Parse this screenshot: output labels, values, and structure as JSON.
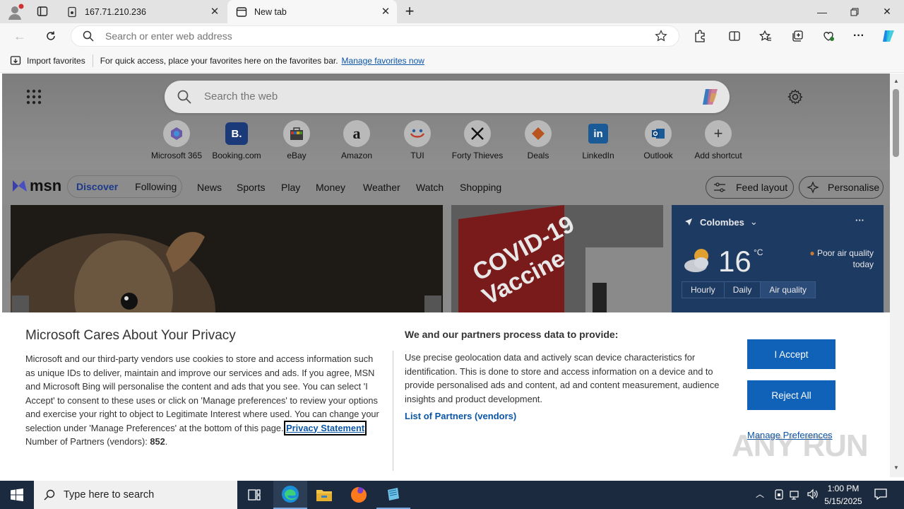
{
  "browser": {
    "tabs": [
      {
        "title": "167.71.210.236",
        "active": false
      },
      {
        "title": "New tab",
        "active": true
      }
    ],
    "address": {
      "placeholder": "Search or enter web address"
    },
    "favorites_bar": {
      "import_label": "Import favorites",
      "message": "For quick access, place your favorites here on the favorites bar.",
      "manage_link": "Manage favorites now"
    }
  },
  "newtab": {
    "search_placeholder": "Search the web",
    "shortcuts": [
      {
        "label": "Microsoft 365",
        "icon": "microsoft365-icon"
      },
      {
        "label": "Booking.com",
        "icon": "booking-icon",
        "glyph": "B."
      },
      {
        "label": "eBay",
        "icon": "ebay-icon"
      },
      {
        "label": "Amazon",
        "icon": "amazon-icon",
        "glyph": "a"
      },
      {
        "label": "TUI",
        "icon": "tui-icon"
      },
      {
        "label": "Forty Thieves",
        "icon": "swords-icon"
      },
      {
        "label": "Deals",
        "icon": "deals-icon"
      },
      {
        "label": "LinkedIn",
        "icon": "linkedin-icon",
        "glyph": "in"
      },
      {
        "label": "Outlook",
        "icon": "outlook-icon"
      },
      {
        "label": "Add shortcut",
        "icon": "plus-icon",
        "glyph": "+"
      }
    ],
    "msn": {
      "logo": "msn",
      "tabs": {
        "discover": "Discover",
        "following": "Following"
      },
      "nav": [
        "News",
        "Sports",
        "Play",
        "Money",
        "Weather",
        "Watch",
        "Shopping"
      ],
      "feed_layout": "Feed layout",
      "personalise": "Personalise"
    },
    "weather": {
      "location": "Colombes",
      "temp": "16",
      "unit": "°C",
      "air_quality": "Poor air quality",
      "air_quality_when": "today",
      "tabs": [
        "Hourly",
        "Daily",
        "Air quality"
      ]
    }
  },
  "consent": {
    "title": "Microsoft Cares About Your Privacy",
    "body_before": "Microsoft and our third-party vendors use cookies to store and access information such as unique IDs to deliver, maintain and improve our services and ads. If you agree, MSN and Microsoft Bing will personalise the content and ads that you see. You can select 'I Accept' to consent to these uses or click on 'Manage preferences' to review your options and exercise your right to object to Legitimate Interest where used.  You can change your selection under 'Manage Preferences' at the bottom of this page.",
    "privacy_link": "Privacy Statement",
    "partners_label": "Number of Partners (vendors):",
    "partners_count": "852",
    "partners_suffix": ".",
    "purposes_heading": "We and our partners process data to provide:",
    "purposes_text": "Use precise geolocation data and actively scan device characteristics for identification. This is done to store and access information on a device and to provide personalised ads and content, ad and content measurement, audience insights and product development.",
    "list_link": "List of Partners (vendors)",
    "accept": "I Accept",
    "reject": "Reject All",
    "manage": "Manage Preferences"
  },
  "taskbar": {
    "search_placeholder": "Type here to search",
    "time": "1:00 PM",
    "date": "5/15/2025"
  },
  "watermark": "ANY RUN"
}
